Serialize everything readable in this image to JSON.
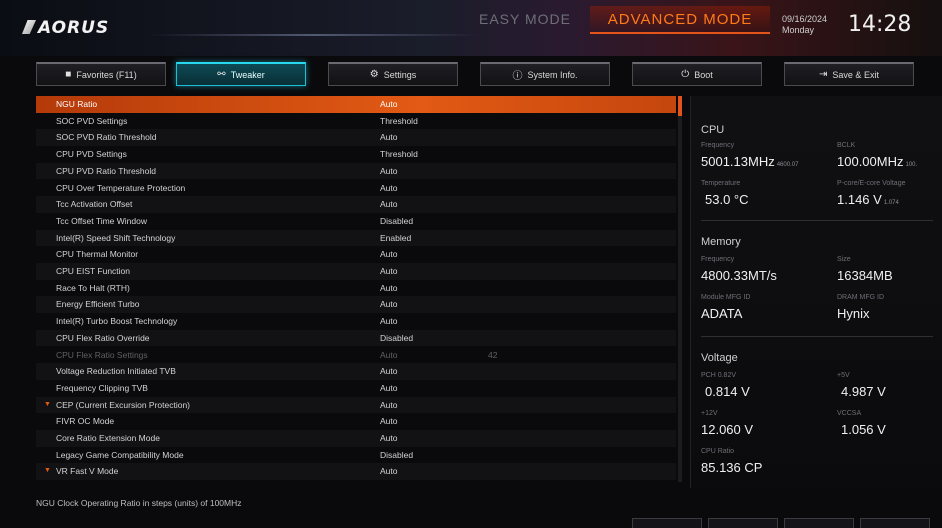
{
  "header": {
    "logo": "AORUS",
    "mode_easy": "EASY MODE",
    "mode_advanced": "ADVANCED MODE",
    "date": "09/16/2024",
    "weekday": "Monday",
    "time": "14:28"
  },
  "tabs": [
    {
      "label": "Favorites (F11)",
      "icon": "star-icon"
    },
    {
      "label": "Tweaker",
      "icon": "tweaker-icon",
      "active": true
    },
    {
      "label": "Settings",
      "icon": "gear-icon"
    },
    {
      "label": "System Info.",
      "icon": "info-icon"
    },
    {
      "label": "Boot",
      "icon": "power-icon"
    },
    {
      "label": "Save & Exit",
      "icon": "exit-icon"
    }
  ],
  "settings": [
    {
      "label": "NGU Ratio",
      "value": "Auto",
      "selected": true
    },
    {
      "label": "SOC PVD Settings",
      "value": "Threshold"
    },
    {
      "label": "SOC PVD Ratio Threshold",
      "value": "Auto"
    },
    {
      "label": "CPU PVD Settings",
      "value": "Threshold"
    },
    {
      "label": "CPU PVD Ratio Threshold",
      "value": "Auto"
    },
    {
      "label": "CPU Over Temperature Protection",
      "value": "Auto"
    },
    {
      "label": "Tcc Activation Offset",
      "value": "Auto"
    },
    {
      "label": "Tcc Offset Time Window",
      "value": "Disabled"
    },
    {
      "label": "Intel(R) Speed Shift Technology",
      "value": "Enabled"
    },
    {
      "label": "CPU Thermal Monitor",
      "value": "Auto"
    },
    {
      "label": "CPU EIST Function",
      "value": "Auto"
    },
    {
      "label": "Race To Halt (RTH)",
      "value": "Auto"
    },
    {
      "label": "Energy Efficient Turbo",
      "value": "Auto"
    },
    {
      "label": "Intel(R) Turbo Boost Technology",
      "value": "Auto"
    },
    {
      "label": "CPU Flex Ratio Override",
      "value": "Disabled"
    },
    {
      "label": "CPU Flex Ratio Settings",
      "value": "Auto",
      "value2": "42",
      "dim": true
    },
    {
      "label": "Voltage Reduction Initiated TVB",
      "value": "Auto"
    },
    {
      "label": "Frequency Clipping TVB",
      "value": "Auto"
    },
    {
      "label": "CEP (Current Excursion Protection)",
      "value": "Auto",
      "expandable": true
    },
    {
      "label": "FIVR OC Mode",
      "value": "Auto"
    },
    {
      "label": "Core Ratio Extension Mode",
      "value": "Auto"
    },
    {
      "label": "Legacy Game Compatibility Mode",
      "value": "Disabled"
    },
    {
      "label": "VR Fast V Mode",
      "value": "Auto",
      "expandable": true
    }
  ],
  "help_text": "NGU Clock Operating Ratio in steps (units) of 100MHz",
  "info": {
    "cpu": {
      "title": "CPU",
      "frequency_label": "Frequency",
      "frequency": "5001.13MHz",
      "frequency_sub": "4600.07",
      "bclk_label": "BCLK",
      "bclk": "100.00MHz",
      "bclk_sub": "100.",
      "temp_label": "Temperature",
      "temp": "53.0 °C",
      "vcore_label": "P-core/E-core Voltage",
      "vcore": "1.146 V",
      "vcore_sub": "1.074"
    },
    "memory": {
      "title": "Memory",
      "frequency_label": "Frequency",
      "frequency": "4800.33MT/s",
      "size_label": "Size",
      "size": "16384MB",
      "module_label": "Module MFG ID",
      "module": "ADATA",
      "dram_label": "DRAM MFG ID",
      "dram": "Hynix"
    },
    "voltage": {
      "title": "Voltage",
      "pch_label": "PCH 0.82V",
      "pch": "0.814 V",
      "v5_label": "+5V",
      "v5": "4.987 V",
      "v12_label": "+12V",
      "v12": "12.060 V",
      "vccsa_label": "VCCSA",
      "vccsa": "1.056 V",
      "ratio_label": "CPU Ratio",
      "ratio": "85.136 CP"
    }
  },
  "colors": {
    "accent": "#e2541a",
    "tab_active": "#19c0d8"
  }
}
